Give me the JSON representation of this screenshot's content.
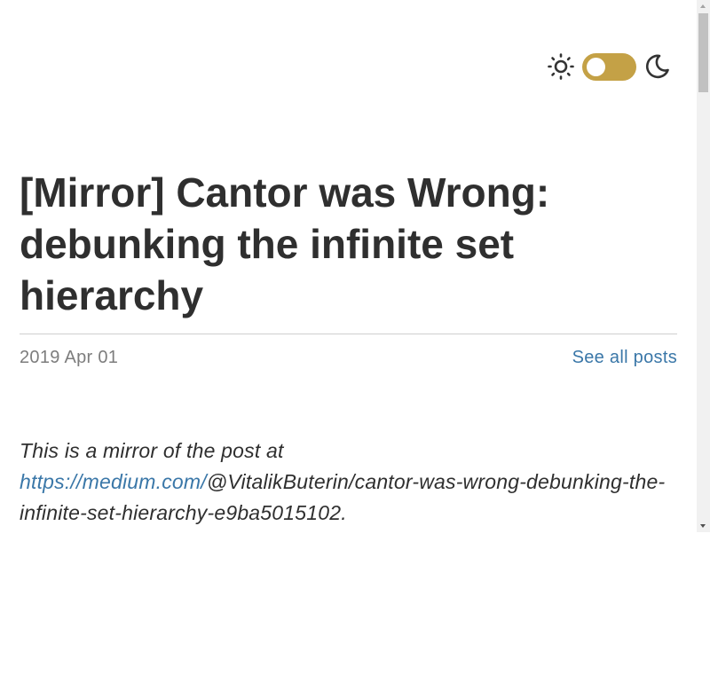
{
  "theme": {
    "light_icon": "sun-icon",
    "dark_icon": "moon-icon",
    "toggle_color": "#c4a146",
    "mode": "light"
  },
  "post": {
    "title": "[Mirror] Cantor was Wrong: debunking the infinite set hierarchy",
    "date": "2019 Apr 01",
    "see_all_label": "See all posts",
    "mirror_prefix": "This is a mirror of the post at ",
    "mirror_link_text": "https://medium.com/",
    "mirror_suffix": "@VitalikButerin/cantor-was-wrong-debunking-the-infinite-set-hierarchy-e9ba5015102."
  },
  "colors": {
    "text": "#2f2f2f",
    "link": "#3a77a8",
    "meta": "#7d7d7d",
    "accent": "#c4a146"
  }
}
